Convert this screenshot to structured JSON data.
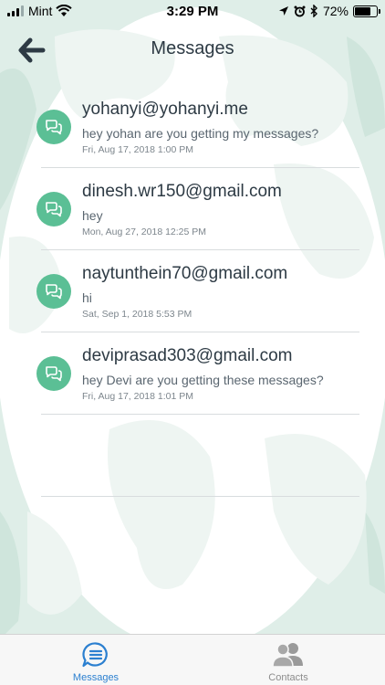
{
  "status_bar": {
    "carrier": "Mint",
    "time": "3:29 PM",
    "battery_text": "72%",
    "battery_level": 0.72
  },
  "header": {
    "title": "Messages",
    "back_icon": "arrow-left-icon"
  },
  "messages": [
    {
      "sender": "yohanyi@yohanyi.me",
      "preview": "hey yohan are you getting my messages?",
      "date": "Fri, Aug 17, 2018 1:00 PM"
    },
    {
      "sender": "dinesh.wr150@gmail.com",
      "preview": "hey",
      "date": "Mon, Aug 27, 2018 12:25 PM"
    },
    {
      "sender": "naytunthein70@gmail.com",
      "preview": "hi",
      "date": "Sat, Sep 1, 2018 5:53 PM"
    },
    {
      "sender": "deviprasad303@gmail.com",
      "preview": "hey Devi are you getting these messages?",
      "date": "Fri, Aug 17, 2018 1:01 PM"
    }
  ],
  "tab_bar": {
    "messages_label": "Messages",
    "contacts_label": "Contacts",
    "active": "messages"
  },
  "colors": {
    "accent": "#2c80d0",
    "avatar": "#5bbf95",
    "title": "#2d3a44",
    "background": "#dfeee8"
  }
}
